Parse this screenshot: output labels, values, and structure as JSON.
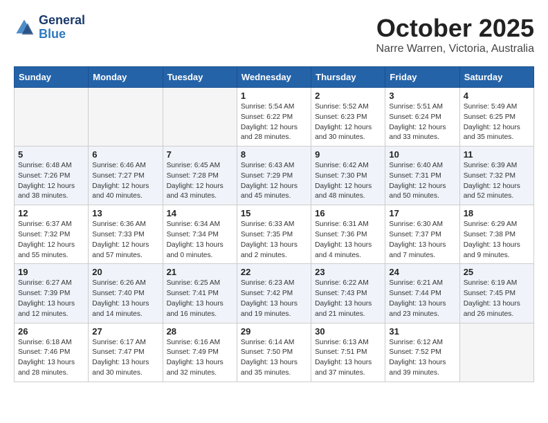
{
  "header": {
    "logo_line1": "General",
    "logo_line2": "Blue",
    "title": "October 2025",
    "subtitle": "Narre Warren, Victoria, Australia"
  },
  "weekdays": [
    "Sunday",
    "Monday",
    "Tuesday",
    "Wednesday",
    "Thursday",
    "Friday",
    "Saturday"
  ],
  "weeks": [
    [
      {
        "day": "",
        "info": ""
      },
      {
        "day": "",
        "info": ""
      },
      {
        "day": "",
        "info": ""
      },
      {
        "day": "1",
        "info": "Sunrise: 5:54 AM\nSunset: 6:22 PM\nDaylight: 12 hours\nand 28 minutes."
      },
      {
        "day": "2",
        "info": "Sunrise: 5:52 AM\nSunset: 6:23 PM\nDaylight: 12 hours\nand 30 minutes."
      },
      {
        "day": "3",
        "info": "Sunrise: 5:51 AM\nSunset: 6:24 PM\nDaylight: 12 hours\nand 33 minutes."
      },
      {
        "day": "4",
        "info": "Sunrise: 5:49 AM\nSunset: 6:25 PM\nDaylight: 12 hours\nand 35 minutes."
      }
    ],
    [
      {
        "day": "5",
        "info": "Sunrise: 6:48 AM\nSunset: 7:26 PM\nDaylight: 12 hours\nand 38 minutes."
      },
      {
        "day": "6",
        "info": "Sunrise: 6:46 AM\nSunset: 7:27 PM\nDaylight: 12 hours\nand 40 minutes."
      },
      {
        "day": "7",
        "info": "Sunrise: 6:45 AM\nSunset: 7:28 PM\nDaylight: 12 hours\nand 43 minutes."
      },
      {
        "day": "8",
        "info": "Sunrise: 6:43 AM\nSunset: 7:29 PM\nDaylight: 12 hours\nand 45 minutes."
      },
      {
        "day": "9",
        "info": "Sunrise: 6:42 AM\nSunset: 7:30 PM\nDaylight: 12 hours\nand 48 minutes."
      },
      {
        "day": "10",
        "info": "Sunrise: 6:40 AM\nSunset: 7:31 PM\nDaylight: 12 hours\nand 50 minutes."
      },
      {
        "day": "11",
        "info": "Sunrise: 6:39 AM\nSunset: 7:32 PM\nDaylight: 12 hours\nand 52 minutes."
      }
    ],
    [
      {
        "day": "12",
        "info": "Sunrise: 6:37 AM\nSunset: 7:32 PM\nDaylight: 12 hours\nand 55 minutes."
      },
      {
        "day": "13",
        "info": "Sunrise: 6:36 AM\nSunset: 7:33 PM\nDaylight: 12 hours\nand 57 minutes."
      },
      {
        "day": "14",
        "info": "Sunrise: 6:34 AM\nSunset: 7:34 PM\nDaylight: 13 hours\nand 0 minutes."
      },
      {
        "day": "15",
        "info": "Sunrise: 6:33 AM\nSunset: 7:35 PM\nDaylight: 13 hours\nand 2 minutes."
      },
      {
        "day": "16",
        "info": "Sunrise: 6:31 AM\nSunset: 7:36 PM\nDaylight: 13 hours\nand 4 minutes."
      },
      {
        "day": "17",
        "info": "Sunrise: 6:30 AM\nSunset: 7:37 PM\nDaylight: 13 hours\nand 7 minutes."
      },
      {
        "day": "18",
        "info": "Sunrise: 6:29 AM\nSunset: 7:38 PM\nDaylight: 13 hours\nand 9 minutes."
      }
    ],
    [
      {
        "day": "19",
        "info": "Sunrise: 6:27 AM\nSunset: 7:39 PM\nDaylight: 13 hours\nand 12 minutes."
      },
      {
        "day": "20",
        "info": "Sunrise: 6:26 AM\nSunset: 7:40 PM\nDaylight: 13 hours\nand 14 minutes."
      },
      {
        "day": "21",
        "info": "Sunrise: 6:25 AM\nSunset: 7:41 PM\nDaylight: 13 hours\nand 16 minutes."
      },
      {
        "day": "22",
        "info": "Sunrise: 6:23 AM\nSunset: 7:42 PM\nDaylight: 13 hours\nand 19 minutes."
      },
      {
        "day": "23",
        "info": "Sunrise: 6:22 AM\nSunset: 7:43 PM\nDaylight: 13 hours\nand 21 minutes."
      },
      {
        "day": "24",
        "info": "Sunrise: 6:21 AM\nSunset: 7:44 PM\nDaylight: 13 hours\nand 23 minutes."
      },
      {
        "day": "25",
        "info": "Sunrise: 6:19 AM\nSunset: 7:45 PM\nDaylight: 13 hours\nand 26 minutes."
      }
    ],
    [
      {
        "day": "26",
        "info": "Sunrise: 6:18 AM\nSunset: 7:46 PM\nDaylight: 13 hours\nand 28 minutes."
      },
      {
        "day": "27",
        "info": "Sunrise: 6:17 AM\nSunset: 7:47 PM\nDaylight: 13 hours\nand 30 minutes."
      },
      {
        "day": "28",
        "info": "Sunrise: 6:16 AM\nSunset: 7:49 PM\nDaylight: 13 hours\nand 32 minutes."
      },
      {
        "day": "29",
        "info": "Sunrise: 6:14 AM\nSunset: 7:50 PM\nDaylight: 13 hours\nand 35 minutes."
      },
      {
        "day": "30",
        "info": "Sunrise: 6:13 AM\nSunset: 7:51 PM\nDaylight: 13 hours\nand 37 minutes."
      },
      {
        "day": "31",
        "info": "Sunrise: 6:12 AM\nSunset: 7:52 PM\nDaylight: 13 hours\nand 39 minutes."
      },
      {
        "day": "",
        "info": ""
      }
    ]
  ]
}
